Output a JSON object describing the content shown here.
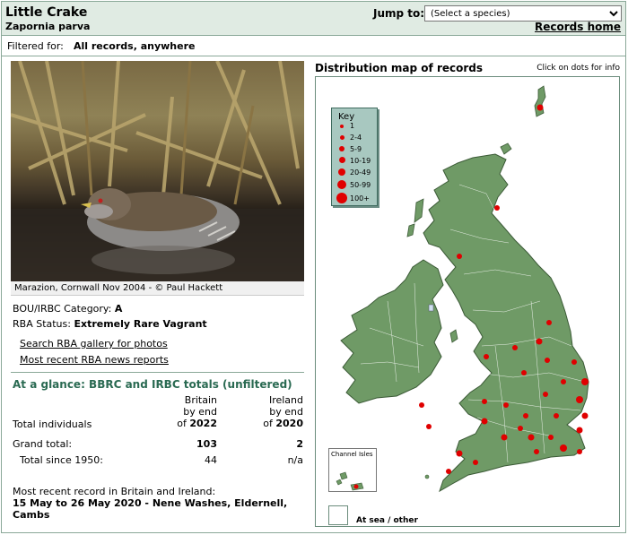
{
  "header": {
    "title": "Little Crake",
    "scientific_name": "Zapornia parva",
    "jump_label": "Jump to:",
    "species_select_value": "(Select a species)",
    "records_home": "Records home"
  },
  "filter": {
    "label": "Filtered for:",
    "value": "All records, anywhere"
  },
  "photo": {
    "caption": "Marazion, Cornwall Nov 2004 - © Paul Hackett"
  },
  "status": {
    "bou_label": "BOU/IRBC Category:",
    "bou_value": "A",
    "rba_label": "RBA Status:",
    "rba_value": "Extremely Rare Vagrant"
  },
  "links": {
    "gallery": "Search RBA gallery for photos",
    "news": "Most recent RBA news reports"
  },
  "glance": {
    "title": "At a glance: BBRC and IRBC totals (unfiltered)",
    "britain_header": [
      "Britain",
      "by end",
      "of"
    ],
    "britain_year": "2022",
    "ireland_header": [
      "Ireland",
      "by end",
      "of"
    ],
    "ireland_year": "2020",
    "rows": [
      {
        "label": "Total individuals",
        "britain": "",
        "ireland": ""
      },
      {
        "label": "Grand total:",
        "britain": "103",
        "ireland": "2"
      },
      {
        "label": "Total since 1950:",
        "britain": "44",
        "ireland": "n/a"
      }
    ]
  },
  "recent": {
    "label": "Most recent record in Britain and Ireland:",
    "value": "15 May to 26 May 2020 - Nene Washes, Eldernell, Cambs"
  },
  "map": {
    "title": "Distribution map of records",
    "hint": "Click on dots for info",
    "key_title": "Key",
    "key_items": [
      "1",
      "2-4",
      "5-9",
      "10-19",
      "20-49",
      "50-99",
      "100+"
    ],
    "channel_isles_label": "Channel Isles",
    "sea_label": "At sea / other",
    "colors": {
      "land": "#6f9a66",
      "dot": "#e00000",
      "key_bg": "#a8c8c0"
    }
  }
}
